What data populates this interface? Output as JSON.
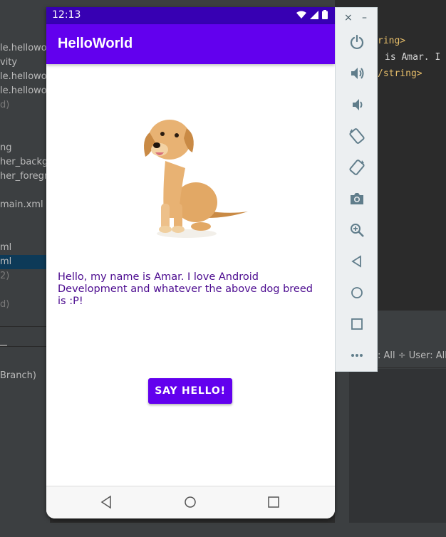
{
  "ide": {
    "left_rows": [
      "le.hellowo",
      "vity",
      "le.hellowo",
      "le.hellowo",
      "d)",
      "ng",
      "her_backg",
      "her_foregr",
      "main.xml",
      "ml",
      "ml",
      "2)",
      "d)",
      "Branch)"
    ],
    "code_lines": [
      "ring>",
      "is Amar. I",
      "/string>"
    ],
    "panel_header": ": All ÷  User: All"
  },
  "device": {
    "status": {
      "time": "12:13"
    },
    "app_title": "HelloWorld",
    "message": "Hello, my name is Amar. I love Android Development and whatever the above dog breed is :P!",
    "button_label": "SAY HELLO!",
    "nav": [
      "back",
      "home",
      "recents"
    ]
  },
  "emulator_toolbar": {
    "window_controls": [
      "×",
      "–"
    ],
    "tools": [
      "power",
      "volume-up",
      "volume-down",
      "rotate-left",
      "rotate-right",
      "screenshot",
      "zoom",
      "back",
      "home",
      "overview",
      "more"
    ]
  },
  "colors": {
    "primary": "#6200ee",
    "primary_dark": "#3700b3",
    "text": "#4b0a8f"
  }
}
